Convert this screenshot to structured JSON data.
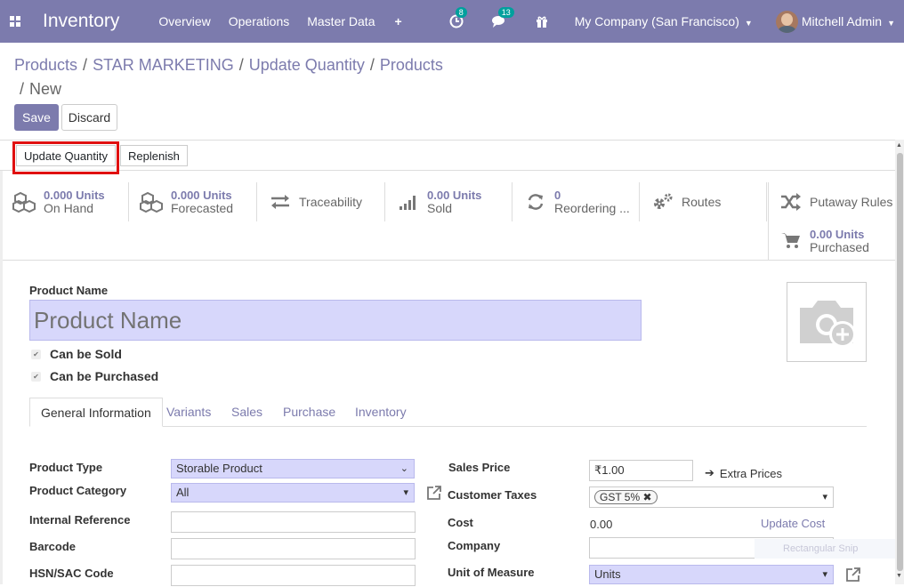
{
  "app": {
    "name": "Inventory"
  },
  "nav": {
    "menu": [
      "Overview",
      "Operations",
      "Master Data",
      "+"
    ],
    "activity_badge": "8",
    "messages_badge": "13",
    "company": "My Company (San Francisco)",
    "user": "Mitchell Admin"
  },
  "breadcrumb": {
    "items": [
      "Products",
      "STAR MARKETING",
      "Update Quantity",
      "Products"
    ],
    "current": "New"
  },
  "actions": {
    "save": "Save",
    "discard": "Discard"
  },
  "statusbar": {
    "update_quantity": "Update Quantity",
    "replenish": "Replenish"
  },
  "smart_buttons": [
    {
      "value": "0.000 Units",
      "label": "On Hand",
      "icon": "cubes-icon"
    },
    {
      "value": "0.000 Units",
      "label": "Forecasted",
      "icon": "cubes-icon"
    },
    {
      "value": "",
      "label": "Traceability",
      "icon": "arrows-exchange-icon"
    },
    {
      "value": "0.00 Units",
      "label": "Sold",
      "icon": "signal-bars-icon"
    },
    {
      "value": "0",
      "label": "Reordering ...",
      "icon": "refresh-icon"
    },
    {
      "value": "",
      "label": "Routes",
      "icon": "cogs-icon"
    },
    {
      "value": "",
      "label": "Putaway Rules",
      "icon": "random-icon"
    },
    {
      "value": "0.00 Units",
      "label": "Purchased",
      "icon": "cart-icon"
    }
  ],
  "form": {
    "name_label": "Product Name",
    "name_placeholder": "Product Name",
    "can_be_sold": "Can be Sold",
    "can_be_purchased": "Can be Purchased"
  },
  "tabs": [
    "General Information",
    "Variants",
    "Sales",
    "Purchase",
    "Inventory"
  ],
  "general": {
    "product_type_label": "Product Type",
    "product_type_value": "Storable Product",
    "product_category_label": "Product Category",
    "product_category_value": "All",
    "internal_reference_label": "Internal Reference",
    "barcode_label": "Barcode",
    "hsn_label": "HSN/SAC Code",
    "sales_price_label": "Sales Price",
    "sales_price_value": "₹1.00",
    "extra_prices": "Extra Prices",
    "customer_taxes_label": "Customer Taxes",
    "tax_tag": "GST 5%",
    "cost_label": "Cost",
    "cost_value": "0.00",
    "update_cost": "Update Cost",
    "company_label": "Company",
    "uom_label": "Unit of Measure",
    "uom_value": "Units"
  },
  "overlay": {
    "snip": "Rectangular Snip"
  },
  "colors": {
    "brand": "#7c7bad",
    "input_required": "#d7d7fb",
    "highlight": "#e01010",
    "badge": "#00a09d"
  }
}
